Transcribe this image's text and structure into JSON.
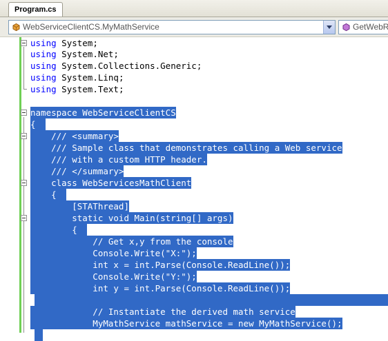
{
  "tab": {
    "label": "Program.cs"
  },
  "navbar": {
    "type_combo": "WebServiceClientCS.MyMathService",
    "member_combo": "GetWebRe"
  },
  "code": {
    "using_kw": "using",
    "u1": " System;",
    "u2": " System.Net;",
    "u3": " System.Collections.Generic;",
    "u4": " System.Linq;",
    "u5": " System.Text;",
    "l_namespace": "namespace WebServiceClientCS",
    "l_open1": "{",
    "l_sum1": "    /// <summary>",
    "l_sum2": "    /// Sample class that demonstrates calling a Web service",
    "l_sum3": "    /// with a custom HTTP header.",
    "l_sum4": "    /// </summary>",
    "l_class": "    class WebServicesMathClient",
    "l_open2": "    {",
    "l_attr": "        [STAThread]",
    "l_main": "        static void Main(string[] args)",
    "l_open3": "        {",
    "l_c1": "            // Get x,y from the console",
    "l_c2": "            Console.Write(\"X:\");",
    "l_c3": "            int x = int.Parse(Console.ReadLine());",
    "l_c4": "            Console.Write(\"Y:\");",
    "l_c5": "            int y = int.Parse(Console.ReadLine());",
    "l_c6": "            // Instantiate the derived math service",
    "l_c7": "            MyMathService mathService = new MyMathService();"
  }
}
